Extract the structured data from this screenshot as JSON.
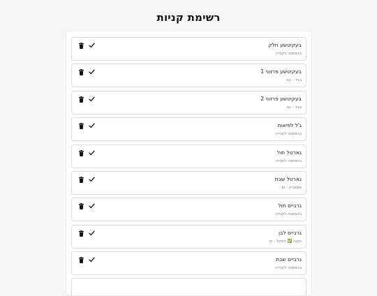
{
  "page": {
    "title": "רשימת קניות"
  },
  "items": [
    {
      "name": "בעקיטשע חלק",
      "detail": "בהמתנה לקנייה"
    },
    {
      "name": "בעקיטשע פרזוני 1",
      "detail": "בגיר - בב"
    },
    {
      "name": "בעקיטשע פרזוני 2",
      "detail": "בגיר - בב"
    },
    {
      "name": "ג'ל לפיאות",
      "detail": "בהמתנה לקנייה"
    },
    {
      "name": "גארטל חול",
      "detail": "בהמתנה לקנייה"
    },
    {
      "name": "גארטל שבת",
      "detail": "שטארק - ים"
    },
    {
      "name": "גרביים חול",
      "detail": "בהמתנה לקנייה"
    },
    {
      "name": "גרביים לבן",
      "detail": "נקנה ✅ דסקל - ים"
    },
    {
      "name": "גרביים שבת",
      "detail": "בהמתנה לקנייה"
    },
    {
      "name": "",
      "detail": ""
    }
  ],
  "icons": {
    "delete": "trash-icon",
    "done": "check-icon"
  }
}
